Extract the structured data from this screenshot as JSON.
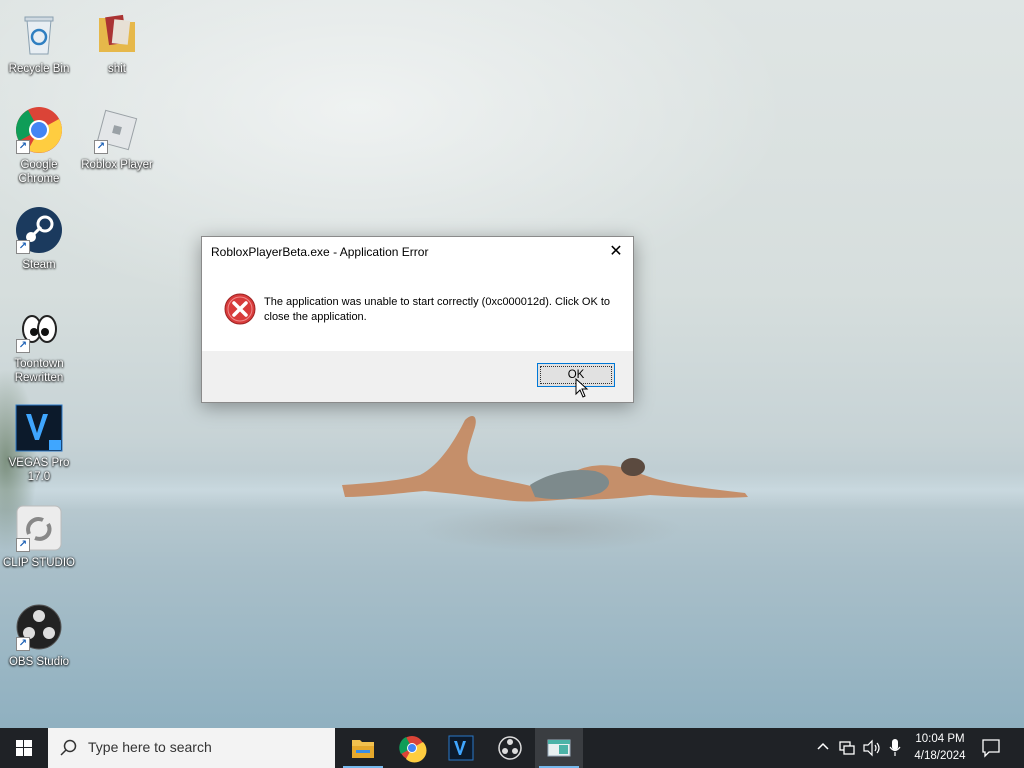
{
  "desktop": {
    "icons": [
      {
        "label": "Recycle Bin",
        "icon": "recycle-bin-icon"
      },
      {
        "label": "shit",
        "icon": "folder-icon"
      },
      {
        "label": "Google Chrome",
        "icon": "chrome-icon"
      },
      {
        "label": "Roblox Player",
        "icon": "roblox-icon"
      },
      {
        "label": "Steam",
        "icon": "steam-icon"
      },
      {
        "label": "Toontown Rewritten",
        "icon": "toontown-icon"
      },
      {
        "label": "VEGAS Pro 17.0",
        "icon": "vegas-pro-icon"
      },
      {
        "label": "CLIP STUDIO",
        "icon": "clip-studio-icon"
      },
      {
        "label": "OBS Studio",
        "icon": "obs-icon"
      }
    ]
  },
  "dialog": {
    "title": "RobloxPlayerBeta.exe - Application Error",
    "message": "The application was unable to start correctly (0xc000012d). Click OK to close the application.",
    "ok_label": "OK",
    "close_glyph": "✕"
  },
  "taskbar": {
    "search_placeholder": "Type here to search",
    "apps": [
      "file-explorer-icon",
      "chrome-icon",
      "vegas-pro-icon",
      "obs-icon",
      "roblox-window-icon"
    ],
    "tray": {
      "chevron": "^",
      "time": "10:04 PM",
      "date": "4/18/2024"
    }
  },
  "colors": {
    "taskbar_bg": "#1f2226",
    "accent": "#0078d7",
    "error_red": "#d83b3b"
  }
}
